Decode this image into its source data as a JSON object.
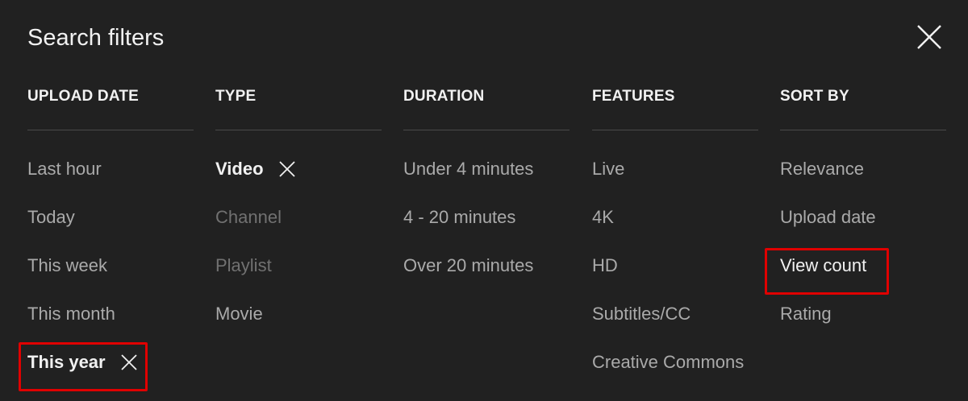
{
  "dialog": {
    "title": "Search filters",
    "close_icon": "close-icon"
  },
  "columns": [
    {
      "header": "UPLOAD DATE",
      "options": [
        {
          "label": "Last hour",
          "state": "normal"
        },
        {
          "label": "Today",
          "state": "normal"
        },
        {
          "label": "This week",
          "state": "normal"
        },
        {
          "label": "This month",
          "state": "normal"
        },
        {
          "label": "This year",
          "state": "selected"
        }
      ]
    },
    {
      "header": "TYPE",
      "options": [
        {
          "label": "Video",
          "state": "selected"
        },
        {
          "label": "Channel",
          "state": "disabled"
        },
        {
          "label": "Playlist",
          "state": "disabled"
        },
        {
          "label": "Movie",
          "state": "normal"
        }
      ]
    },
    {
      "header": "DURATION",
      "options": [
        {
          "label": "Under 4 minutes",
          "state": "normal"
        },
        {
          "label": "4 - 20 minutes",
          "state": "normal"
        },
        {
          "label": "Over 20 minutes",
          "state": "normal"
        }
      ]
    },
    {
      "header": "FEATURES",
      "options": [
        {
          "label": "Live",
          "state": "normal"
        },
        {
          "label": "4K",
          "state": "normal"
        },
        {
          "label": "HD",
          "state": "normal"
        },
        {
          "label": "Subtitles/CC",
          "state": "normal"
        },
        {
          "label": "Creative Commons",
          "state": "normal"
        }
      ]
    },
    {
      "header": "SORT BY",
      "options": [
        {
          "label": "Relevance",
          "state": "normal"
        },
        {
          "label": "Upload date",
          "state": "normal"
        },
        {
          "label": "View count",
          "state": "sorted"
        },
        {
          "label": "Rating",
          "state": "normal"
        }
      ]
    }
  ],
  "colors": {
    "background": "#212121",
    "text_primary": "#f1f1f1",
    "text_secondary": "#aaaaaa",
    "text_disabled": "#717171",
    "divider": "#4a4a4a",
    "highlight": "#e00000"
  }
}
